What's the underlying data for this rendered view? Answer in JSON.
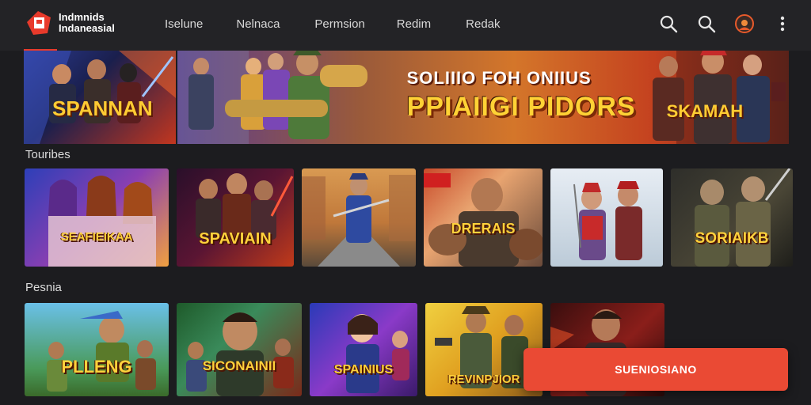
{
  "header": {
    "logo_line1": "Indmnids",
    "logo_line2": "Indaneasial",
    "nav": [
      "Iselune",
      "Nelnaca",
      "Permsion",
      "Redim",
      "Redak"
    ]
  },
  "hero": {
    "left_badge": "SPANNAN",
    "subtitle": "SOLIIIO FOH ONIIUS",
    "title": "PPIAIIGI PIDORS",
    "right_badge": "SKAMAH"
  },
  "sections": [
    {
      "title": "Touribes",
      "cards": [
        {
          "label": "SEAFIEIKAA"
        },
        {
          "label": "SPAVIAIN"
        },
        {
          "label": ""
        },
        {
          "label": "DRERAIS"
        },
        {
          "label": ""
        },
        {
          "label": "SORIAIKB"
        }
      ]
    },
    {
      "title": "Pesnia",
      "cards": [
        {
          "label": "PLLENG"
        },
        {
          "label": "SICONAINII"
        },
        {
          "label": "SPAINIUS"
        },
        {
          "label": "REVINPJIOR"
        },
        {
          "label": ""
        }
      ]
    }
  ],
  "cta": {
    "label": "SUENIOSIANO"
  },
  "colors": {
    "accent": "#ea4a34",
    "background": "#1c1c1f",
    "topbar": "#232326",
    "gold": "#ffd23c"
  },
  "icons": [
    "search-icon",
    "search-icon",
    "avatar-icon",
    "more-vertical-icon"
  ]
}
